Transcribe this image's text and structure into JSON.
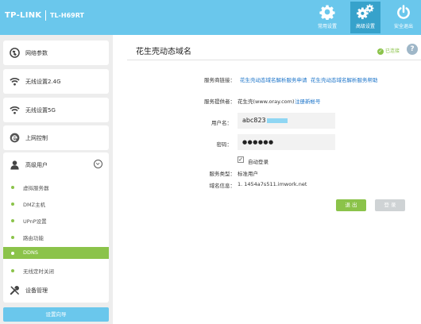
{
  "header": {
    "brand": "TP-LINK",
    "model": "TL-H69RT",
    "nav": [
      {
        "label": "常用设置",
        "icon": "gear-icon"
      },
      {
        "label": "高级设置",
        "icon": "gears-icon"
      },
      {
        "label": "安全退出",
        "icon": "power-icon"
      }
    ],
    "active_color": "#37a2cb"
  },
  "sidebar": {
    "items": [
      {
        "label": "网络参数",
        "icon": "globe-icon"
      },
      {
        "label": "无线设置2.4G",
        "icon": "wifi-icon"
      },
      {
        "label": "无线设置5G",
        "icon": "wifi-icon"
      },
      {
        "label": "上网控制",
        "icon": "e-icon"
      },
      {
        "label": "高级用户",
        "icon": "user-icon"
      },
      {
        "label": "设备管理",
        "icon": "tools-icon"
      }
    ],
    "submenu": [
      "虚拟服务器",
      "DMZ主机",
      "UPnP设置",
      "路由功能",
      "DDNS",
      "无线定时关闭"
    ],
    "active_sub": "DDNS",
    "wizard": "设置向导"
  },
  "main": {
    "title": "花生壳动态域名",
    "status": "已连接",
    "help": "?",
    "links_label": "服务商链接：",
    "link1": "花生壳动态域名解析服务申请",
    "link2": "花生壳动态域名解析服务帮助",
    "provider_label": "服务提供者：",
    "provider": "花生壳(www.oray.com)",
    "register": "注册新帐号",
    "username_label": "用户名：",
    "username": "abc823",
    "password_label": "密码：",
    "password": "●●●●●●",
    "autologin_checked": "✓",
    "autologin": "自动登录",
    "service_type_label": "服务类型：",
    "service_type": "标准用户",
    "domain_label": "域名信息：",
    "domain": "1. 1454a7s511.imwork.net",
    "logout": "退 出",
    "login": "登 录"
  },
  "colors": {
    "header": "#6ac7ec",
    "accent_green": "#8bc34a",
    "link": "#1a73c9",
    "login_disabled": "#cfd3d5"
  }
}
